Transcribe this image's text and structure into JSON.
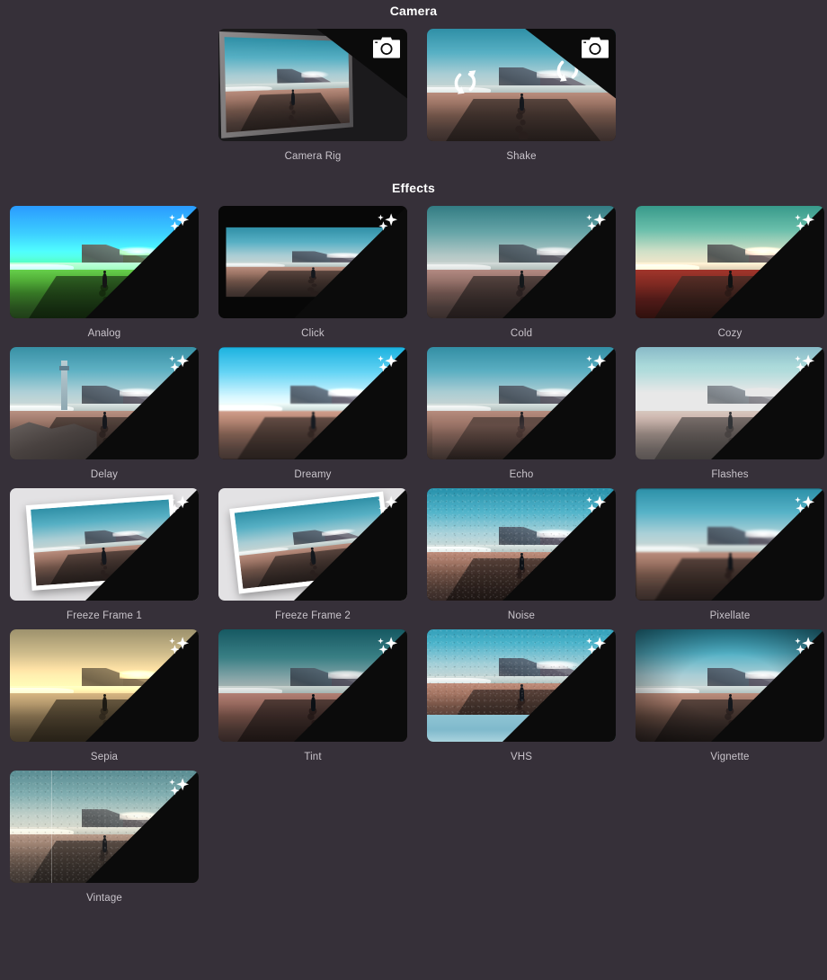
{
  "sections": [
    {
      "id": "camera",
      "title": "Camera",
      "badge_icon": "camera-icon",
      "items": [
        {
          "label": "Camera Rig",
          "fx": "fx-rig"
        },
        {
          "label": "Shake",
          "fx": "fx-shake"
        }
      ]
    },
    {
      "id": "effects",
      "title": "Effects",
      "badge_icon": "sparkles-icon",
      "items": [
        {
          "label": "Analog",
          "fx": "fx-analog"
        },
        {
          "label": "Click",
          "fx": "fx-click"
        },
        {
          "label": "Cold",
          "fx": "fx-cold"
        },
        {
          "label": "Cozy",
          "fx": "fx-cozy"
        },
        {
          "label": "Delay",
          "fx": "fx-delay"
        },
        {
          "label": "Dreamy",
          "fx": "fx-dreamy"
        },
        {
          "label": "Echo",
          "fx": "fx-echo"
        },
        {
          "label": "Flashes",
          "fx": "fx-flashes"
        },
        {
          "label": "Freeze Frame 1",
          "fx": "fx-freeze fx-freeze1"
        },
        {
          "label": "Freeze Frame 2",
          "fx": "fx-freeze fx-freeze2"
        },
        {
          "label": "Noise",
          "fx": "fx-noise"
        },
        {
          "label": "Pixellate",
          "fx": "fx-pixellate"
        },
        {
          "label": "Sepia",
          "fx": "fx-sepia"
        },
        {
          "label": "Tint",
          "fx": "fx-tint"
        },
        {
          "label": "VHS",
          "fx": "fx-vhs"
        },
        {
          "label": "Vignette",
          "fx": "fx-vignette"
        },
        {
          "label": "Vintage",
          "fx": "fx-vintage"
        }
      ]
    }
  ],
  "colors": {
    "background": "#363039",
    "header_text": "#ffffff",
    "label_text": "#c9c4cb",
    "badge_wedge": "#0b0b0b"
  }
}
